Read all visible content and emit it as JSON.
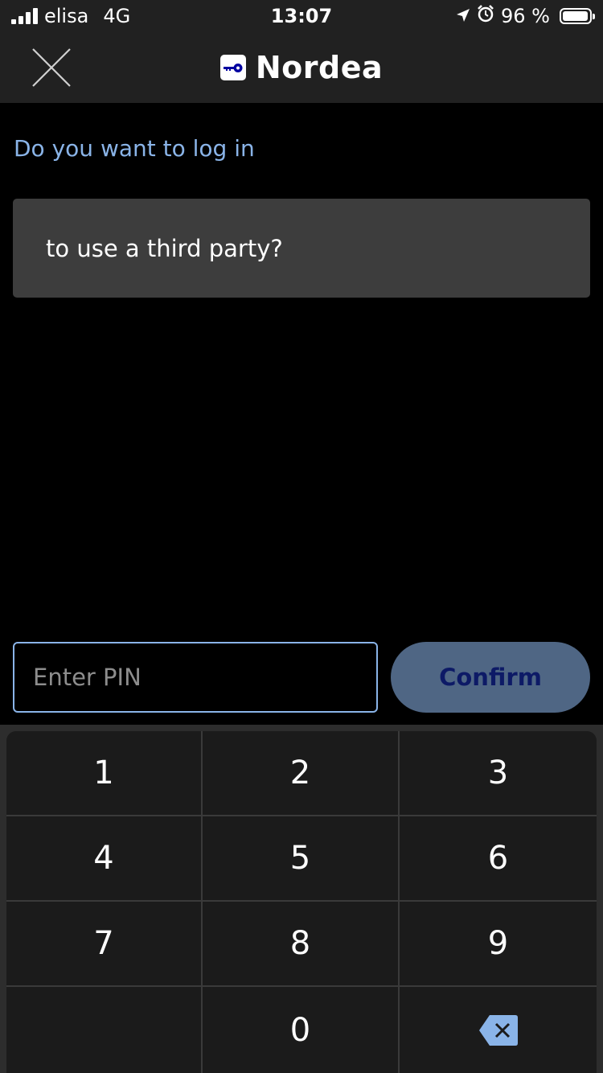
{
  "status_bar": {
    "carrier": "elisa",
    "network": "4G",
    "time": "13:07",
    "battery": "96 %",
    "battery_level": 0.96,
    "signal_strength": 4,
    "icons": [
      "signal-icon",
      "location-arrow-icon",
      "alarm-icon",
      "battery-icon"
    ]
  },
  "header": {
    "close_icon": "close-icon",
    "brand": "Nordea",
    "logo_icon": "key-icon"
  },
  "content": {
    "question": "Do you want to log in",
    "card_text": "to use a third party?"
  },
  "pin": {
    "placeholder": "Enter PIN",
    "value": "",
    "confirm_label": "Confirm"
  },
  "keypad": {
    "keys": [
      "1",
      "2",
      "3",
      "4",
      "5",
      "6",
      "7",
      "8",
      "9",
      "",
      "0"
    ],
    "backspace_icon": "backspace-icon"
  },
  "colors": {
    "accent": "#8ab4e8",
    "header_bg": "#212121",
    "card_bg": "#3d3d3d",
    "confirm_bg": "#4f6684",
    "confirm_text": "#0d1a66",
    "keypad_bg": "#1b1b1b",
    "logo_blue": "#0000a0"
  }
}
